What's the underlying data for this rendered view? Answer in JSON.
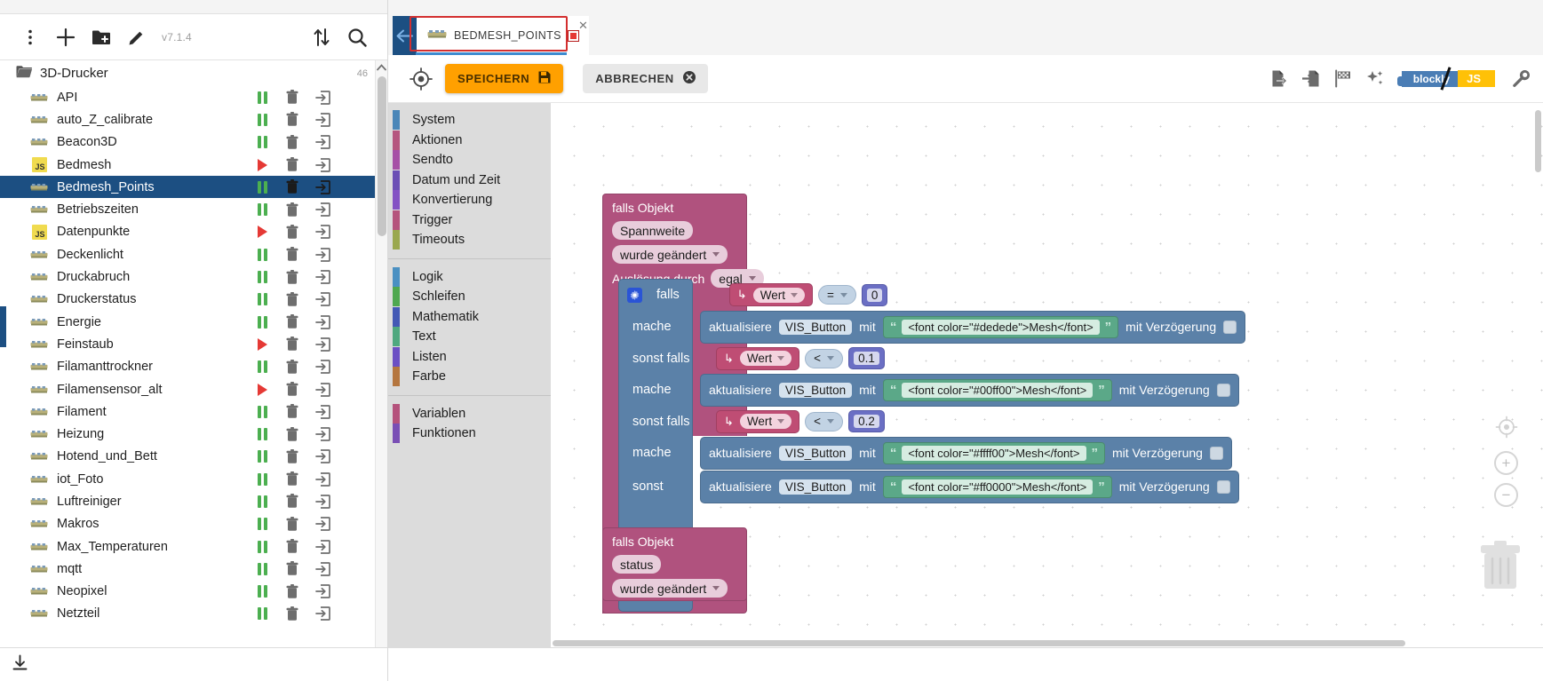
{
  "left": {
    "toolbar": {
      "menu_icon": "kebab-menu-icon",
      "add_label": "+",
      "add_folder_icon": "folder-plus-icon",
      "edit_icon": "pencil-icon",
      "version": "v7.1.4",
      "sort_icon": "sort-arrows-icon",
      "search_icon": "search-icon"
    },
    "folder": {
      "name": "3D-Drucker",
      "count": "46"
    },
    "items": [
      {
        "label": "API",
        "type": "blockly",
        "state": "pause"
      },
      {
        "label": "auto_Z_calibrate",
        "type": "blockly",
        "state": "pause"
      },
      {
        "label": "Beacon3D",
        "type": "blockly",
        "state": "pause"
      },
      {
        "label": "Bedmesh",
        "type": "js",
        "state": "play"
      },
      {
        "label": "Bedmesh_Points",
        "type": "blockly",
        "state": "pause",
        "selected": true
      },
      {
        "label": "Betriebszeiten",
        "type": "blockly",
        "state": "pause"
      },
      {
        "label": "Datenpunkte",
        "type": "js",
        "state": "play"
      },
      {
        "label": "Deckenlicht",
        "type": "blockly",
        "state": "pause"
      },
      {
        "label": "Druckabruch",
        "type": "blockly",
        "state": "pause"
      },
      {
        "label": "Druckerstatus",
        "type": "blockly",
        "state": "pause"
      },
      {
        "label": "Energie",
        "type": "blockly",
        "state": "pause"
      },
      {
        "label": "Feinstaub",
        "type": "blockly",
        "state": "play"
      },
      {
        "label": "Filamanttrockner",
        "type": "blockly",
        "state": "pause"
      },
      {
        "label": "Filamensensor_alt",
        "type": "blockly",
        "state": "play"
      },
      {
        "label": "Filament",
        "type": "blockly",
        "state": "pause"
      },
      {
        "label": "Heizung",
        "type": "blockly",
        "state": "pause"
      },
      {
        "label": "Hotend_und_Bett",
        "type": "blockly",
        "state": "pause"
      },
      {
        "label": "iot_Foto",
        "type": "blockly",
        "state": "pause"
      },
      {
        "label": "Luftreiniger",
        "type": "blockly",
        "state": "pause"
      },
      {
        "label": "Makros",
        "type": "blockly",
        "state": "pause"
      },
      {
        "label": "Max_Temperaturen",
        "type": "blockly",
        "state": "pause"
      },
      {
        "label": "mqtt",
        "type": "blockly",
        "state": "pause"
      },
      {
        "label": "Neopixel",
        "type": "blockly",
        "state": "pause"
      },
      {
        "label": "Netzteil",
        "type": "blockly",
        "state": "pause"
      }
    ],
    "row_icons": {
      "delete": "trash-icon",
      "export": "export-arrow-icon"
    },
    "bottom_icon": "download-icon"
  },
  "tab": {
    "back_icon": "back-arrow-icon",
    "title": "BEDMESH_POINTS",
    "modified_marker": "red-square-marker",
    "close_icon": "close-icon"
  },
  "script_toolbar": {
    "target_icon": "crosshair-icon",
    "save_label": "SPEICHERN",
    "save_icon": "floppy-disk-icon",
    "cancel_label": "ABBRECHEN",
    "cancel_icon": "cancel-circle-icon",
    "right_icons": [
      "export-file-icon",
      "import-file-icon",
      "checkered-flag-icon",
      "sparkle-icon"
    ],
    "toggle": {
      "left_label": "blockly",
      "right_label": "JS"
    },
    "settings_icon": "wrench-icon"
  },
  "toolbox": {
    "groups": [
      {
        "items": [
          {
            "label": "System",
            "color": "#4a86b8"
          },
          {
            "label": "Aktionen",
            "color": "#b5567f"
          },
          {
            "label": "Sendto",
            "color": "#a650a6"
          },
          {
            "label": "Datum und Zeit",
            "color": "#6b4fb5"
          },
          {
            "label": "Konvertierung",
            "color": "#8452c4"
          },
          {
            "label": "Trigger",
            "color": "#b5547c"
          },
          {
            "label": "Timeouts",
            "color": "#9aa84f"
          }
        ]
      },
      {
        "items": [
          {
            "label": "Logik",
            "color": "#4a90c2"
          },
          {
            "label": "Schleifen",
            "color": "#4fa84f"
          },
          {
            "label": "Mathematik",
            "color": "#4359b5"
          },
          {
            "label": "Text",
            "color": "#4fa87f"
          },
          {
            "label": "Listen",
            "color": "#6b4fc4"
          },
          {
            "label": "Farbe",
            "color": "#b5763f"
          }
        ]
      },
      {
        "items": [
          {
            "label": "Variablen",
            "color": "#b5527c"
          },
          {
            "label": "Funktionen",
            "color": "#7a4fb5"
          }
        ]
      }
    ]
  },
  "workspace": {
    "block1": {
      "title": "falls Objekt",
      "object_field": "Spannweite",
      "event_field": "wurde geändert",
      "trigger_label": "Auslösung durch",
      "trigger_value": "egal",
      "if_label": "falls",
      "gear_icon": "gear-icon",
      "branches": [
        {
          "cond_label": "falls",
          "var_name": "Wert",
          "operator": "=",
          "value": "0",
          "do_label": "mache",
          "action_verb": "aktualisiere",
          "action_target": "VIS_Button",
          "action_with": "mit",
          "action_text": "<font color=\"#dedede\">Mesh</font>",
          "delay_label": "mit Verzögerung"
        },
        {
          "cond_label": "sonst falls",
          "var_name": "Wert",
          "operator": "<",
          "value": "0.1",
          "do_label": "mache",
          "action_verb": "aktualisiere",
          "action_target": "VIS_Button",
          "action_with": "mit",
          "action_text": "<font color=\"#00ff00\">Mesh</font>",
          "delay_label": "mit Verzögerung"
        },
        {
          "cond_label": "sonst falls",
          "var_name": "Wert",
          "operator": "<",
          "value": "0.2",
          "do_label": "mache",
          "action_verb": "aktualisiere",
          "action_target": "VIS_Button",
          "action_with": "mit",
          "action_text": "<font color=\"#ffff00\">Mesh</font>",
          "delay_label": "mit Verzögerung"
        }
      ],
      "else": {
        "cond_label": "sonst",
        "action_verb": "aktualisiere",
        "action_target": "VIS_Button",
        "action_with": "mit",
        "action_text": "<font color=\"#ff0000\">Mesh</font>",
        "delay_label": "mit Verzögerung"
      }
    },
    "block2": {
      "title": "falls Objekt",
      "object_field": "status",
      "event_field": "wurde geändert"
    },
    "controls": {
      "center_icon": "center-target-icon",
      "zoom_in": "+",
      "zoom_out": "−",
      "trash_icon": "trash-icon"
    }
  }
}
